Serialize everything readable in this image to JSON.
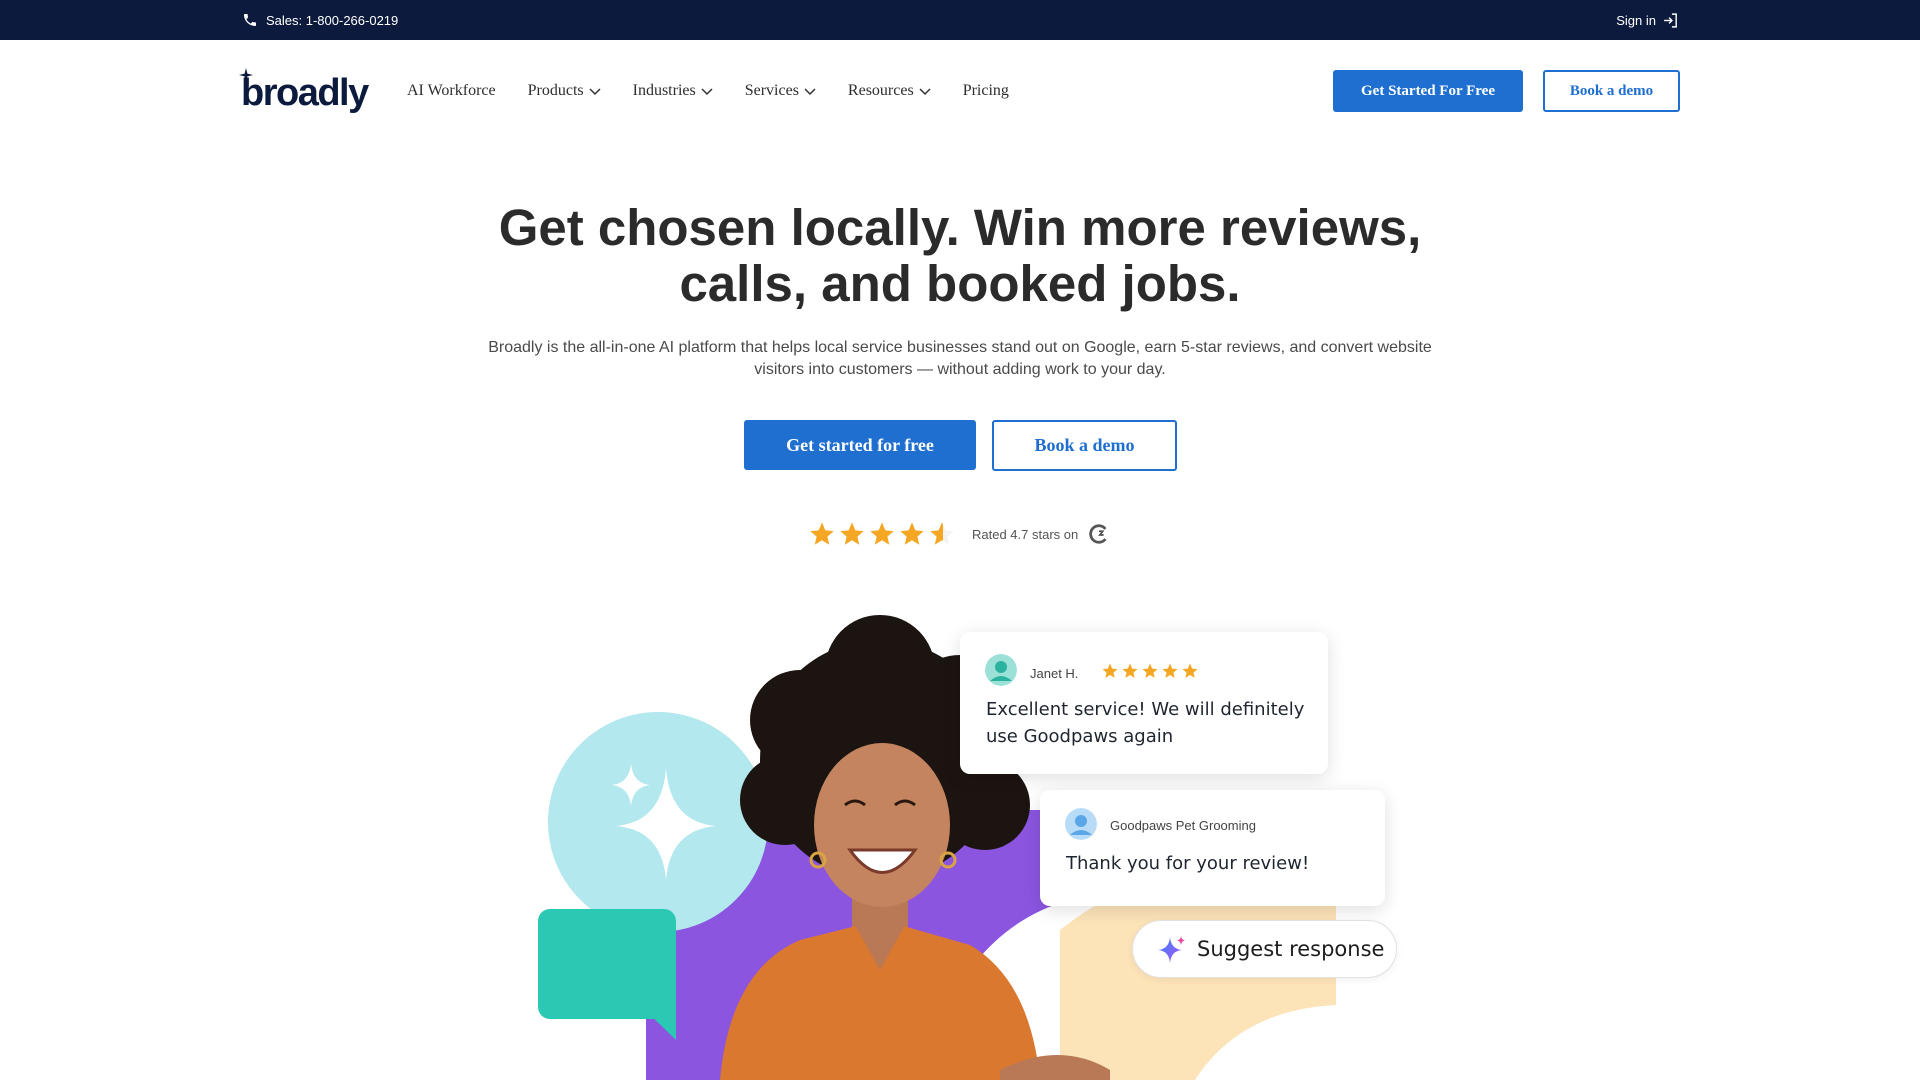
{
  "topbar": {
    "sales_label": "Sales: 1-800-266-0219",
    "signin_label": "Sign in"
  },
  "brand": {
    "logo_text": "broadly",
    "colors": {
      "navy": "#0c1b3d",
      "blue": "#1e6fd0",
      "teal": "#2bc8b4",
      "light_blue": "#b3e8ee",
      "purple": "#8b55e0",
      "peach": "#fde3b8",
      "star": "#f5a623"
    }
  },
  "nav": {
    "items": [
      {
        "label": "AI Workforce",
        "dropdown": false
      },
      {
        "label": "Products",
        "dropdown": true
      },
      {
        "label": "Industries",
        "dropdown": true
      },
      {
        "label": "Services",
        "dropdown": true
      },
      {
        "label": "Resources",
        "dropdown": true
      },
      {
        "label": "Pricing",
        "dropdown": false
      }
    ],
    "cta_primary": "Get Started For Free",
    "cta_secondary": "Book a demo"
  },
  "hero": {
    "title_line1": "Get chosen locally. Win more reviews,",
    "title_line2": "calls, and booked jobs.",
    "subtitle_line1": "Broadly is the all-in-one AI platform that helps local service businesses stand out on Google, earn 5-star reviews, and convert website",
    "subtitle_line2": "visitors into customers — without adding work to your day.",
    "cta_primary": "Get started for free",
    "cta_secondary": "Book a demo",
    "rating": {
      "value": 4.7,
      "max": 5,
      "text": "Rated 4.7 stars on",
      "platform_icon": "g2-icon"
    }
  },
  "illustration": {
    "review_card": {
      "reviewer": "Janet H.",
      "stars": 5,
      "text_line1": "Excellent service! We will definitely",
      "text_line2": "use Goodpaws again"
    },
    "reply_card": {
      "business": "Goodpaws Pet Grooming",
      "text": "Thank you for your review!"
    },
    "suggest_button": {
      "label": "Suggest response",
      "icon": "sparkle-icon"
    }
  }
}
